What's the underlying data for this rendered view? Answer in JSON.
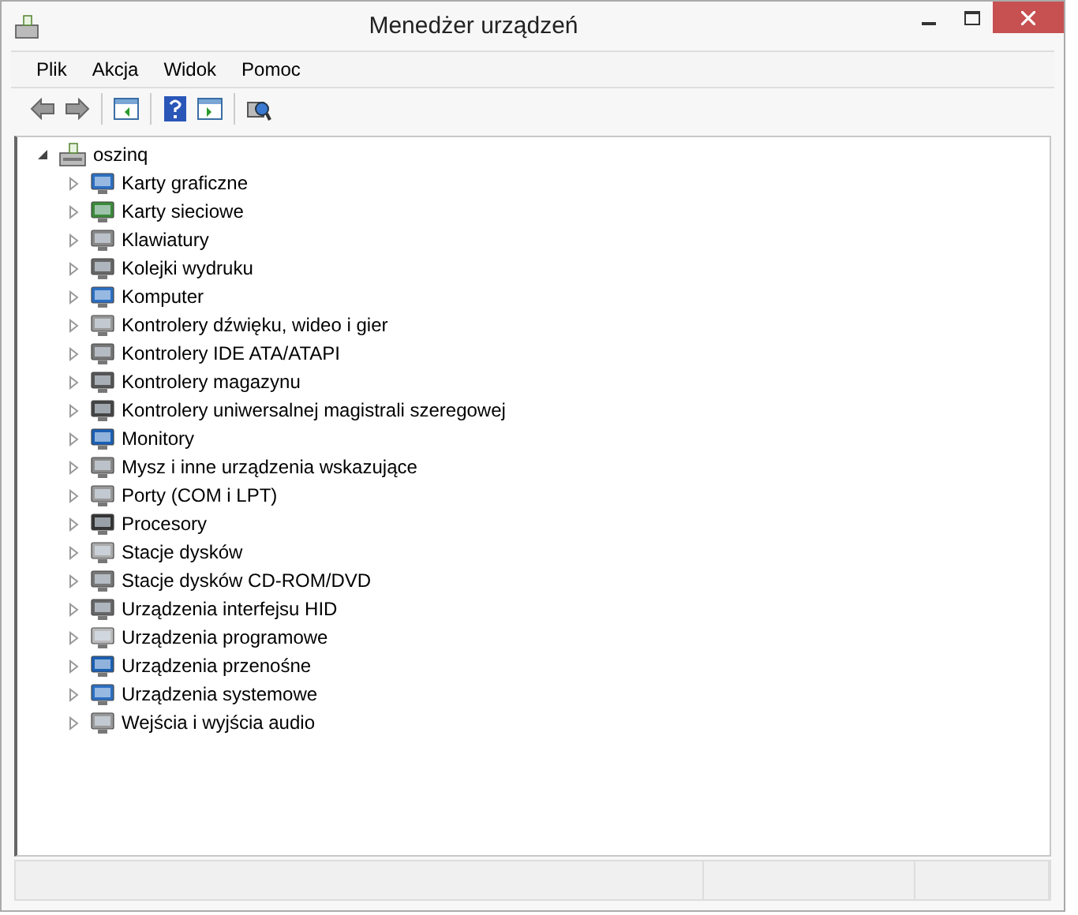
{
  "window": {
    "title": "Menedżer urządzeń"
  },
  "menu": [
    "Plik",
    "Akcja",
    "Widok",
    "Pomoc"
  ],
  "tree": {
    "label": "oszinq",
    "expanded": true,
    "children": [
      {
        "label": "Karty graficzne",
        "expanded": false
      },
      {
        "label": "Karty sieciowe",
        "expanded": false
      },
      {
        "label": "Klawiatury",
        "expanded": false
      },
      {
        "label": "Kolejki wydruku",
        "expanded": false
      },
      {
        "label": "Komputer",
        "expanded": false
      },
      {
        "label": "Kontrolery dźwięku, wideo i gier",
        "expanded": false
      },
      {
        "label": "Kontrolery IDE ATA/ATAPI",
        "expanded": false
      },
      {
        "label": "Kontrolery magazynu",
        "expanded": false
      },
      {
        "label": "Kontrolery uniwersalnej magistrali szeregowej",
        "expanded": false
      },
      {
        "label": "Monitory",
        "expanded": false
      },
      {
        "label": "Mysz i inne urządzenia wskazujące",
        "expanded": false
      },
      {
        "label": "Porty (COM i LPT)",
        "expanded": false
      },
      {
        "label": "Procesory",
        "expanded": false
      },
      {
        "label": "Stacje dysków",
        "expanded": false
      },
      {
        "label": "Stacje dysków CD-ROM/DVD",
        "expanded": false
      },
      {
        "label": "Urządzenia interfejsu HID",
        "expanded": false
      },
      {
        "label": "Urządzenia programowe",
        "expanded": false
      },
      {
        "label": "Urządzenia przenośne",
        "expanded": false
      },
      {
        "label": "Urządzenia systemowe",
        "expanded": false
      },
      {
        "label": "Wejścia i wyjścia audio",
        "expanded": false
      }
    ]
  }
}
